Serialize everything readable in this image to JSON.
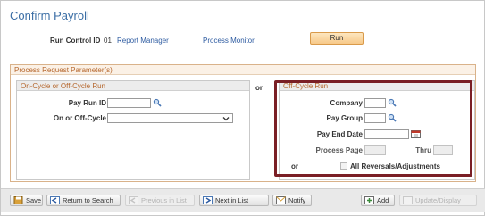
{
  "page": {
    "title": "Confirm Payroll"
  },
  "run_controls": {
    "run_control_id_label": "Run Control ID",
    "run_control_id_value": "01",
    "report_manager_link": "Report Manager",
    "process_monitor_link": "Process Monitor",
    "run_button": "Run"
  },
  "process_request": {
    "header": "Process Request Parameter(s)",
    "or_label": "or",
    "on_cycle": {
      "header": "On-Cycle or Off-Cycle Run",
      "pay_run_id_label": "Pay Run ID",
      "pay_run_id_value": "",
      "on_or_off_cycle_label": "On or Off-Cycle",
      "on_or_off_cycle_value": ""
    },
    "off_cycle": {
      "header": "Off-Cycle Run",
      "company_label": "Company",
      "company_value": "",
      "pay_group_label": "Pay Group",
      "pay_group_value": "",
      "pay_end_date_label": "Pay End Date",
      "pay_end_date_value": "",
      "process_page_label": "Process Page",
      "process_page_value": "",
      "thru_label": "Thru",
      "thru_value": "",
      "or_label": "or",
      "all_reversals_label": "All Reversals/Adjustments",
      "all_reversals_checked": false
    },
    "highlight_color": "#7a1f25"
  },
  "toolbar": {
    "save": "Save",
    "return_to_search": "Return to Search",
    "previous_in_list": "Previous in List",
    "next_in_list": "Next in List",
    "notify": "Notify",
    "add": "Add",
    "update_display": "Update/Display"
  },
  "colors": {
    "title": "#3b6ea5",
    "link": "#2c5aa0",
    "section_header": "#b5662c",
    "run_button": "#f7c98a"
  }
}
